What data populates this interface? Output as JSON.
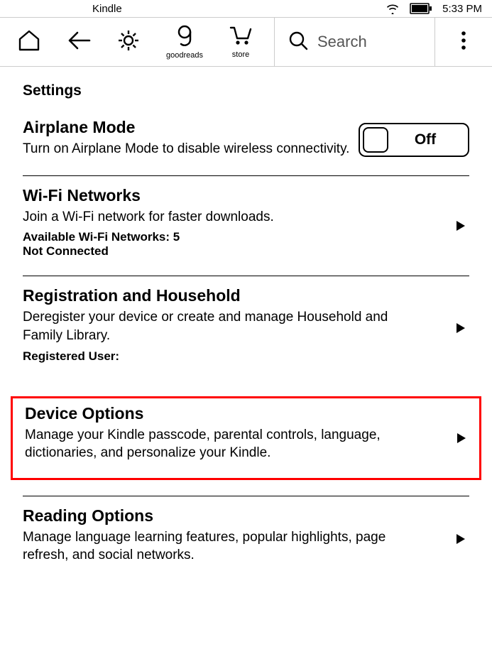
{
  "status": {
    "app_name": "Kindle",
    "time": "5:33 PM"
  },
  "toolbar": {
    "goodreads_label": "goodreads",
    "store_label": "store",
    "search_placeholder": "Search"
  },
  "page": {
    "title": "Settings"
  },
  "settings": {
    "airplane": {
      "title": "Airplane Mode",
      "desc": "Turn on Airplane Mode to disable wireless connectivity.",
      "toggle_state": "Off"
    },
    "wifi": {
      "title": "Wi-Fi Networks",
      "desc": "Join a Wi-Fi network for faster downloads.",
      "available_label": "Available Wi-Fi Networks: 5",
      "status_label": "Not Connected"
    },
    "registration": {
      "title": "Registration and Household",
      "desc": "Deregister your device or create and manage Household and Family Library.",
      "user_label": "Registered User:"
    },
    "device": {
      "title": "Device Options",
      "desc": "Manage your Kindle passcode, parental controls, language, dictionaries, and personalize your Kindle."
    },
    "reading": {
      "title": "Reading Options",
      "desc": "Manage language learning features, popular highlights, page refresh, and social networks."
    }
  }
}
